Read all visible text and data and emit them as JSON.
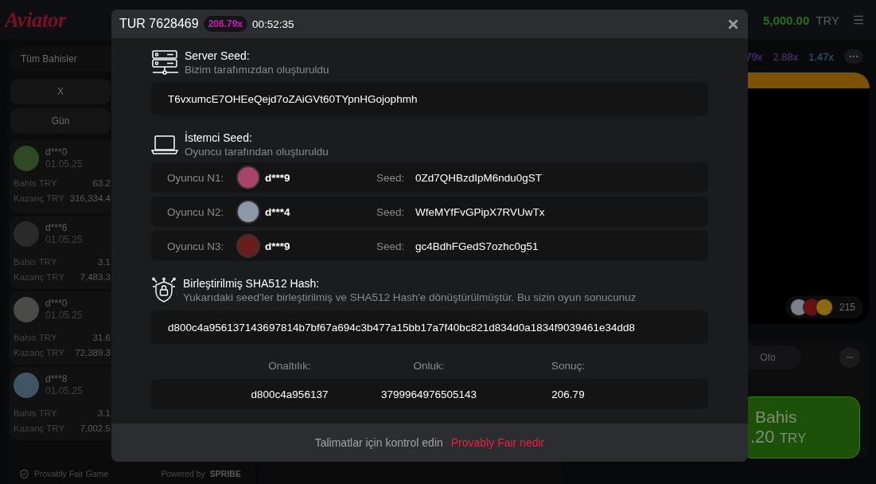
{
  "header": {
    "logo": "Aviator",
    "balance": "5,000.00",
    "currency": "TRY"
  },
  "bets_panel": {
    "tab": "Tüm Bahisler",
    "filters": [
      {
        "label": "X"
      },
      {
        "label": "Gün"
      }
    ],
    "bets": [
      {
        "user": "d***0",
        "date": "01.05.25",
        "stake_label": "Bahis TRY",
        "stake": "63.2",
        "win_label": "Kazanç TRY",
        "win": "316,334.4"
      },
      {
        "user": "d***6",
        "date": "01.05.25",
        "stake_label": "Bahis TRY",
        "stake": "3.1",
        "win_label": "Kazanç TRY",
        "win": "7,483.3"
      },
      {
        "user": "d***0",
        "date": "01.05.25",
        "stake_label": "Bahis TRY",
        "stake": "31.6",
        "win_label": "Kazanç TRY",
        "win": "72,389.3"
      },
      {
        "user": "d***8",
        "date": "01.05.25",
        "stake_label": "Bahis TRY",
        "stake": "3.1",
        "win_label": "Kazanç TRY",
        "win": "7,002.5"
      }
    ],
    "footer": {
      "fair": "Provably Fair Game",
      "powered_by": "Powered by",
      "brand": "SPRIBE"
    }
  },
  "game": {
    "multipliers": [
      {
        "value": "79x",
        "color": "#5e2e85"
      },
      {
        "value": "2.88x",
        "color": "#5e2e85"
      },
      {
        "value": "1.47x",
        "color": "#2d5e86"
      }
    ],
    "players_count": "215"
  },
  "bet_controls": {
    "tab": "Oto",
    "button_label": "Bahis",
    "amount": ".20",
    "currency": "TRY"
  },
  "modal": {
    "round": "TUR 7628469",
    "multiplier": "206.79x",
    "time": "00:52:35",
    "server_seed": {
      "title": "Server Seed:",
      "subtitle": "Bizim tarafımızdan oluşturuldu",
      "value": "T6vxumcE7OHEeQejd7oZAiGVt60TYpnHGojophmh"
    },
    "client_seed": {
      "title": "İstemci Seed:",
      "subtitle": "Oyuncu tarafından oluşturuldu",
      "players": [
        {
          "label": "Oyuncu N1:",
          "user": "d***9",
          "seed_label": "Seed:",
          "seed": "0Zd7QHBzdIpM6ndu0gST"
        },
        {
          "label": "Oyuncu N2:",
          "user": "d***4",
          "seed_label": "Seed:",
          "seed": "WfeMYfFvGPipX7RVUwTx"
        },
        {
          "label": "Oyuncu N3:",
          "user": "d***9",
          "seed_label": "Seed:",
          "seed": "gc4BdhFGedS7ozhc0g51"
        }
      ]
    },
    "hash": {
      "title": "Birleştirilmiş SHA512 Hash:",
      "subtitle": "Yukarıdaki seed'ler birleştirilmiş ve SHA512 Hash'e dönüştürülmüştür. Bu sizin oyun sonucunuz",
      "value": "d800c4a956137143697814b7bf67a694c3b477a15bb17a7f40bc821d834d0a1834f9039461e34dd8"
    },
    "result": {
      "columns": [
        {
          "label": "Onaltılık:",
          "value": "d800c4a956137"
        },
        {
          "label": "Onluk:",
          "value": "3799964976505143"
        },
        {
          "label": "Sonuç:",
          "value": "206.79"
        }
      ]
    },
    "footer": {
      "text": "Talimatlar için kontrol edin",
      "link": "Provably Fair nedir"
    }
  }
}
